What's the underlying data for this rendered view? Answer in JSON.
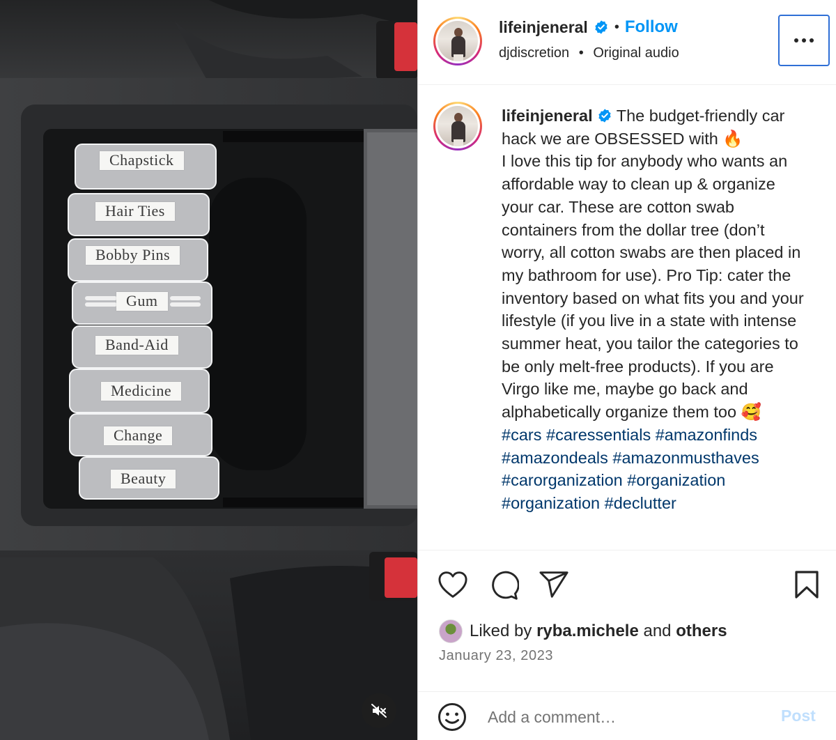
{
  "video": {
    "labels": [
      "Chapstick",
      "Hair Ties",
      "Bobby Pins",
      "Gum",
      "Band-Aid",
      "Medicine",
      "Change",
      "Beauty"
    ],
    "mute_icon": "speaker-muted-icon"
  },
  "header": {
    "username": "lifeinjeneral",
    "separator": "•",
    "follow_label": "Follow",
    "audio_artist": "djdiscretion",
    "audio_separator": "•",
    "audio_title": "Original audio",
    "more_icon": "more-options-icon"
  },
  "caption": {
    "username": "lifeinjeneral",
    "text": " The budget-friendly car hack we are OBSESSED with 🔥\nI love this tip for anybody who wants an affordable way to clean up & organize your car. These are cotton swab containers from the dollar tree (don’t worry, all cotton swabs are then placed in my bathroom for use). Pro Tip: cater the inventory based on what fits you and your lifestyle (if you live in a state with intense summer heat, you tailor the categories to be only melt-free products). If you are Virgo like me, maybe go back and alphabetically organize them too 🥰\n",
    "hashtags": "#cars #caressentials #amazonfinds #amazondeals #amazonmusthaves #carorganization #organization #organization #declutter"
  },
  "actions": {
    "like_icon": "heart-icon",
    "comment_icon": "comment-icon",
    "share_icon": "share-icon",
    "save_icon": "bookmark-icon"
  },
  "likes": {
    "prefix": "Liked by ",
    "user": "ryba.michele",
    "middle": " and ",
    "others": "others"
  },
  "date": "January 23, 2023",
  "comment": {
    "placeholder": "Add a comment…",
    "post_label": "Post",
    "emoji_icon": "emoji-icon"
  }
}
